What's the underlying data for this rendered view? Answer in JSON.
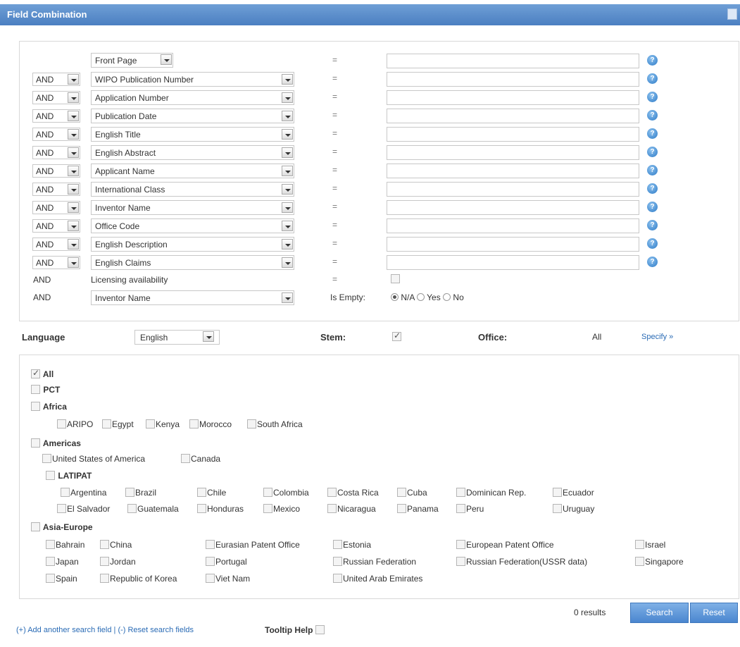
{
  "window": {
    "title": "Field Combination"
  },
  "search_rows": [
    {
      "operator": "",
      "field": "Front Page",
      "eq": "=",
      "value": ""
    },
    {
      "operator": "AND",
      "field": "WIPO Publication Number",
      "eq": "=",
      "value": ""
    },
    {
      "operator": "AND",
      "field": "Application Number",
      "eq": "=",
      "value": ""
    },
    {
      "operator": "AND",
      "field": "Publication Date",
      "eq": "=",
      "value": ""
    },
    {
      "operator": "AND",
      "field": "English Title",
      "eq": "=",
      "value": ""
    },
    {
      "operator": "AND",
      "field": "English Abstract",
      "eq": "=",
      "value": ""
    },
    {
      "operator": "AND",
      "field": "Applicant Name",
      "eq": "=",
      "value": ""
    },
    {
      "operator": "AND",
      "field": "International Class",
      "eq": "=",
      "value": ""
    },
    {
      "operator": "AND",
      "field": "Inventor Name",
      "eq": "=",
      "value": ""
    },
    {
      "operator": "AND",
      "field": "Office Code",
      "eq": "=",
      "value": ""
    },
    {
      "operator": "AND",
      "field": "English Description",
      "eq": "=",
      "value": ""
    },
    {
      "operator": "AND",
      "field": "English Claims",
      "eq": "=",
      "value": ""
    }
  ],
  "licensing_row": {
    "operator": "AND",
    "label": "Licensing availability",
    "eq": "=",
    "checked": false
  },
  "empty_row": {
    "operator": "AND",
    "field": "Inventor Name",
    "label": "Is Empty:",
    "options": [
      "N/A",
      "Yes",
      "No"
    ],
    "selected": "N/A"
  },
  "language_bar": {
    "language_label": "Language",
    "language_value": "English",
    "stem_label": "Stem:",
    "stem_checked": true,
    "office_label": "Office:",
    "office_value": "All",
    "specify_link": "Specify »"
  },
  "offices": {
    "all": {
      "label": "All",
      "checked": true
    },
    "pct": {
      "label": "PCT",
      "checked": false
    },
    "africa": {
      "label": "Africa",
      "items": [
        "ARIPO",
        "Egypt",
        "Kenya",
        "Morocco",
        "South Africa"
      ]
    },
    "americas": {
      "label": "Americas",
      "items": [
        "United States of America",
        "Canada"
      ],
      "latipat": {
        "label": "LATIPAT",
        "row1": [
          "Argentina",
          "Brazil",
          "Chile",
          "Colombia",
          "Costa Rica",
          "Cuba",
          "Dominican Rep.",
          "Ecuador"
        ],
        "row2": [
          "El Salvador",
          "Guatemala",
          "Honduras",
          "Mexico",
          "Nicaragua",
          "Panama",
          "Peru",
          "Uruguay"
        ]
      }
    },
    "asia_europe": {
      "label": "Asia-Europe",
      "row1": [
        "Bahrain",
        "China",
        "Eurasian Patent Office",
        "Estonia",
        "European Patent Office",
        "Israel"
      ],
      "row2": [
        "Japan",
        "Jordan",
        "Portugal",
        "Russian Federation",
        "Russian Federation(USSR data)",
        "Singapore"
      ],
      "row3": [
        "Spain",
        "Republic of Korea",
        "Viet Nam",
        "United Arab Emirates"
      ]
    }
  },
  "bottom": {
    "results_text": "0 results",
    "search_button": "Search",
    "reset_button": "Reset",
    "add_field_link": "(+) Add another search field",
    "separator": "|",
    "reset_fields_link": "(-) Reset search fields",
    "tooltip_help_label": "Tooltip Help"
  },
  "colors": {
    "title_bar": "#5b8ccb",
    "accent": "#4a86cf",
    "link": "#2a6bb5"
  }
}
